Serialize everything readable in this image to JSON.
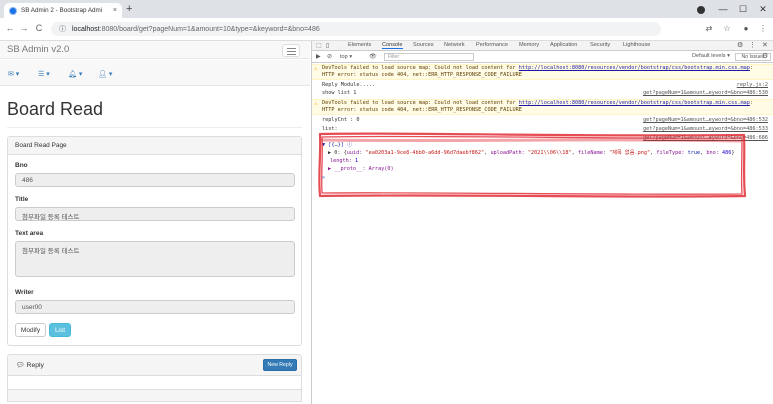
{
  "browser": {
    "tab_title": "SB Admin 2 - Bootstrap Admi",
    "tab_close": "×",
    "new_tab": "+",
    "url_host": "localhost",
    "url_path": ":8080/board/get?pageNum=1&amount=10&type=&keyword=&bno=486",
    "info_icon": "ⓘ",
    "back": "←",
    "forward": "→",
    "reload": "C",
    "win_min": "—",
    "win_max": "☐",
    "win_close": "✕"
  },
  "app": {
    "brand": "SB Admin v2.0",
    "nav_icons": [
      "envelope-icon",
      "tasks-icon",
      "bell-icon",
      "user-icon"
    ]
  },
  "board": {
    "page_title": "Board Read",
    "panel_heading": "Board Read Page",
    "bno_label": "Bno",
    "bno_value": "486",
    "title_label": "Title",
    "title_value": "첨부파일 등록 테스트",
    "text_label": "Text area",
    "text_value": "첨부파일 등록 테스트",
    "writer_label": "Writer",
    "writer_value": "user00",
    "modify_label": "Modify",
    "list_label": "List"
  },
  "reply": {
    "label": "Reply",
    "new_reply_label": "New Reply"
  },
  "devtools": {
    "tabs": [
      "Elements",
      "Console",
      "Sources",
      "Network",
      "Performance",
      "Memory",
      "Application",
      "Security",
      "Lighthouse"
    ],
    "active_tab": "Console",
    "context": "top ▾",
    "filter_placeholder": "Filter",
    "levels": "Default levels ▾",
    "issues": "No Issues",
    "warn1_prefix": "DevTools failed to load source map: Could not load content for ",
    "warn1_link": "http://localhost:8080/resources/vendor/bootstrap/css/bootstrap.min.css.map",
    "warn1_suffix": ": HTTP error: status code 404, net::ERR_HTTP_RESPONSE_CODE_FAILURE",
    "log_reply_module": "Reply Module.....",
    "src_reply": "reply.js:2",
    "log_show_list": "show list 1",
    "src_1": "get?pageNum=1&amount…eyword=&bno=486:530",
    "warn2_prefix": "DevTools failed to load source map: Could not load content for ",
    "warn2_link": "http://localhost:8080/resources/vendor/bootstrap/css/bootstrap.min.css.map",
    "warn2_suffix": ": HTTP error: status code 404, net::ERR_HTTP_RESPONSE_CODE_FAILURE",
    "log_replycnt": "replyCnt : 0",
    "src_2": "get?pageNum=1&amount…eyword=&bno=486:532",
    "log_list": "list:",
    "src_3": "get?pageNum=1&amount…eyword=&bno=486:533",
    "log_array": "▼ [{…}] ⓘ",
    "src_4": "get?pageNum=1&amount…eyword=&bno=486:686",
    "obj_index": "▶ 0:",
    "obj_uuid_key": "uuid:",
    "obj_uuid_val": "\"ea0203a1-9ce8-4bb0-a6dd-96d7daebf862\"",
    "obj_upload_key": "uploadPath:",
    "obj_upload_val": "\"2021\\\\06\\\\18\"",
    "obj_filename_key": "fileName:",
    "obj_filename_val": "\"제목 없음.png\"",
    "obj_filetype_key": "fileType:",
    "obj_filetype_val": "true",
    "obj_bno_key": "bno:",
    "obj_bno_val": "486",
    "length_key": "length:",
    "length_val": "1",
    "proto": "▶ __proto__: Array(0)",
    "prompt": ">"
  },
  "colors": {
    "annotation_red": "#e0202a",
    "accent_blue": "#1a73e8",
    "info_button": "#5bc0de",
    "primary_button": "#337ab7"
  }
}
